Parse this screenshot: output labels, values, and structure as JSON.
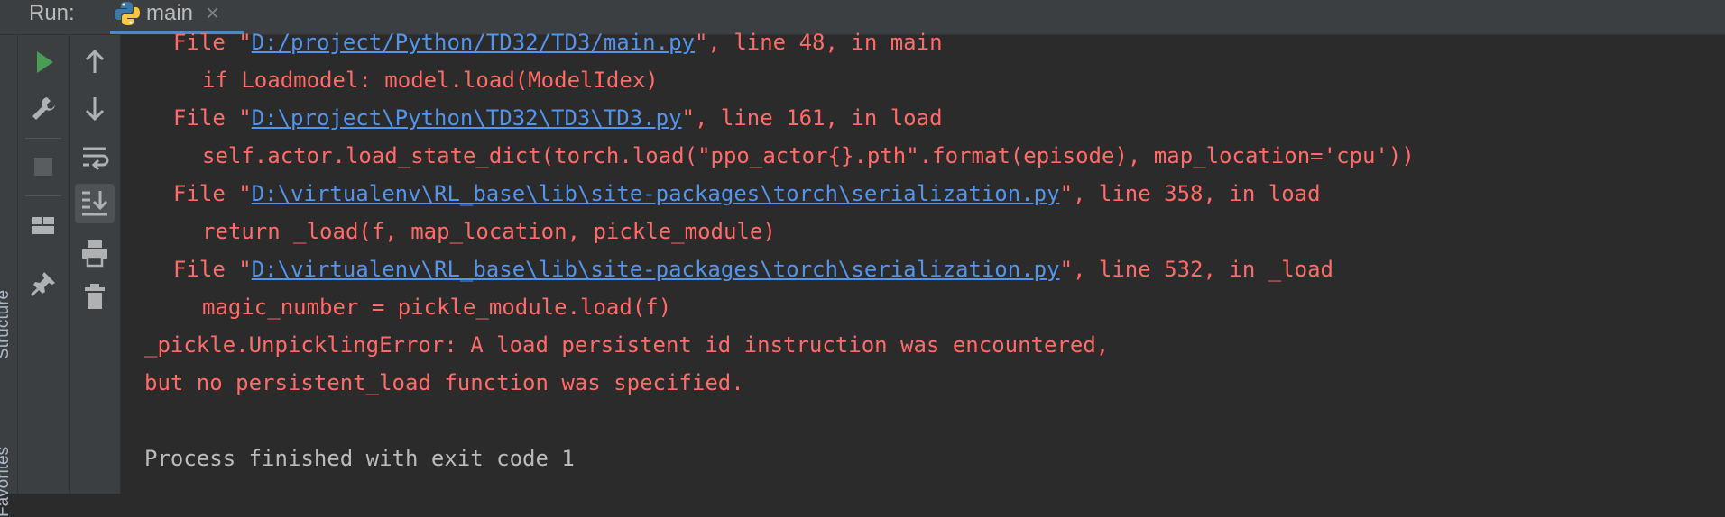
{
  "toolbar": {
    "run_label": "Run:",
    "tab_title": "main"
  },
  "side_tabs": [
    "Structure",
    "Favorites"
  ],
  "tool_icons": [
    "run-icon",
    "wrench-icon",
    "stop-icon",
    "layout-icon",
    "pin-icon",
    "up-arrow-icon",
    "down-arrow-icon",
    "soft-wrap-icon",
    "scroll-to-end-icon",
    "print-icon",
    "trash-icon"
  ],
  "console": {
    "partial_line": {
      "pre": "File \"",
      "link": "D:/project/Python/TD32/TD3/main.py",
      "post": "\", line 48, in main"
    },
    "code1": "if Loadmodel: model.load(ModelIdex)",
    "frame2": {
      "pre": "File \"",
      "link": "D:\\project\\Python\\TD32\\TD3\\TD3.py",
      "post": "\", line 161, in load"
    },
    "code2": "self.actor.load_state_dict(torch.load(\"ppo_actor{}.pth\".format(episode), map_location='cpu'))",
    "frame3": {
      "pre": "File \"",
      "link": "D:\\virtualenv\\RL_base\\lib\\site-packages\\torch\\serialization.py",
      "post": "\", line 358, in load"
    },
    "code3": "return _load(f, map_location, pickle_module)",
    "frame4": {
      "pre": "File \"",
      "link": "D:\\virtualenv\\RL_base\\lib\\site-packages\\torch\\serialization.py",
      "post": "\", line 532, in _load"
    },
    "code4": "magic_number = pickle_module.load(f)",
    "error1": "_pickle.UnpicklingError: A load persistent id instruction was encountered,",
    "error2": "but no persistent_load function was specified.",
    "exit": "Process finished with exit code 1"
  },
  "colors": {
    "background": "#2b2b2b",
    "panel": "#3c3f41",
    "error_text": "#ff6b68",
    "link": "#5394ec",
    "normal_text": "#bbbbbb",
    "run_green": "#499c54"
  }
}
